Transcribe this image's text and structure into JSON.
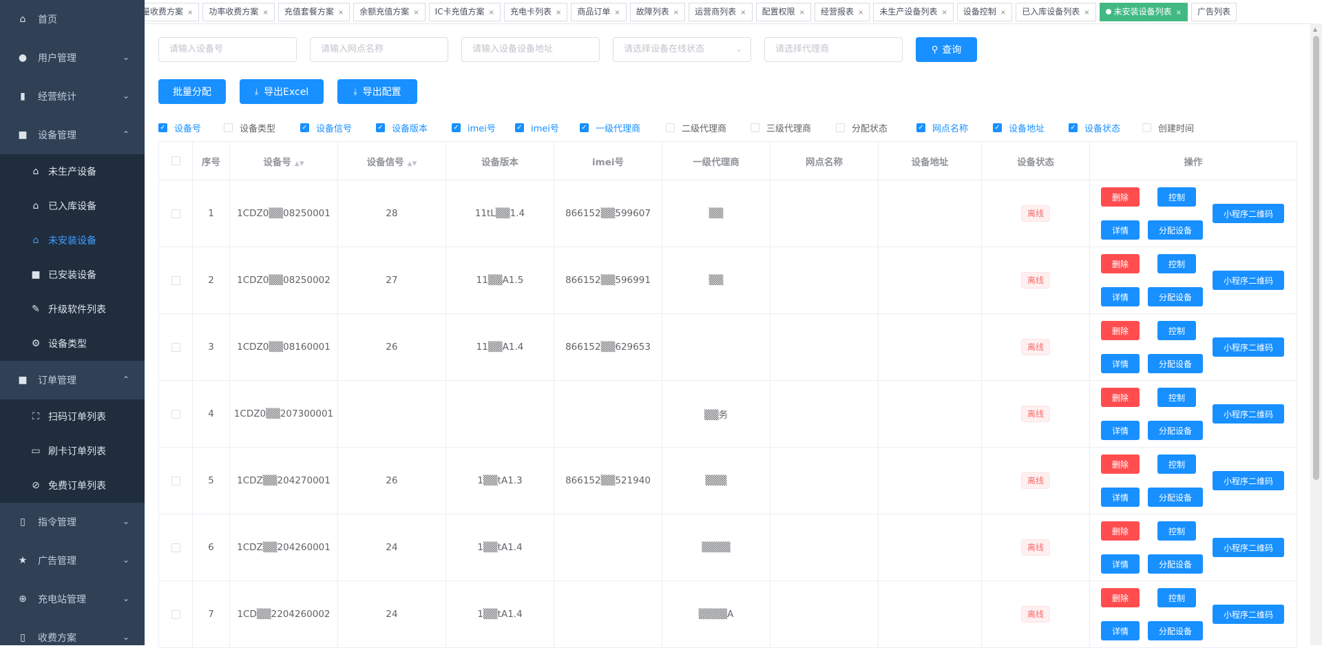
{
  "sidebar": {
    "home": "首页",
    "user_mgmt": "用户管理",
    "biz_stats": "经营统计",
    "device_mgmt": "设备管理",
    "device_items": [
      {
        "label": "未生产设备",
        "icon": "bag-icon"
      },
      {
        "label": "已入库设备",
        "icon": "bag-in-icon"
      },
      {
        "label": "未安装设备",
        "icon": "bag-plus-icon"
      },
      {
        "label": "已安装设备",
        "icon": "bag-check-icon"
      },
      {
        "label": "升级软件列表",
        "icon": "pen-icon"
      },
      {
        "label": "设备类型",
        "icon": "gear-icon"
      }
    ],
    "order_mgmt": "订单管理",
    "order_items": [
      {
        "label": "扫码订单列表",
        "icon": "scan-icon"
      },
      {
        "label": "刷卡订单列表",
        "icon": "card-icon"
      },
      {
        "label": "免费订单列表",
        "icon": "link-icon"
      }
    ],
    "cmd_mgmt": "指令管理",
    "ad_mgmt": "广告管理",
    "station_mgmt": "充电站管理",
    "fee_plan": "收费方案"
  },
  "tags": [
    "量收费方案",
    "功率收费方案",
    "充值套餐方案",
    "余额充值方案",
    "IC卡充值方案",
    "充电卡列表",
    "商品订单",
    "故障列表",
    "运营商列表",
    "配置权限",
    "经营报表",
    "未生产设备列表",
    "设备控制",
    "已入库设备列表",
    "未安装设备列表",
    "广告列表"
  ],
  "active_tag_index": 14,
  "filters": {
    "device_no_placeholder": "请输入设备号",
    "site_name_placeholder": "请输入网点名称",
    "address_placeholder": "请输入设备设备地址",
    "status_placeholder": "请选择设备在线状态",
    "agent_placeholder": "请选择代理商",
    "query_label": "查询"
  },
  "actions": {
    "batch_assign": "批量分配",
    "export_excel": "导出Excel",
    "export_config": "导出配置"
  },
  "column_toggles": [
    {
      "label": "设备号",
      "checked": true
    },
    {
      "label": "设备类型",
      "checked": false
    },
    {
      "label": "设备信号",
      "checked": true
    },
    {
      "label": "设备版本",
      "checked": true
    },
    {
      "label": "imei号",
      "checked": true
    },
    {
      "label": "imei号",
      "checked": true
    },
    {
      "label": "一级代理商",
      "checked": true
    },
    {
      "label": "二级代理商",
      "checked": false
    },
    {
      "label": "三级代理商",
      "checked": false
    },
    {
      "label": "分配状态",
      "checked": false
    },
    {
      "label": "网点名称",
      "checked": true
    },
    {
      "label": "设备地址",
      "checked": true
    },
    {
      "label": "设备状态",
      "checked": true
    },
    {
      "label": "创建时间",
      "checked": false
    }
  ],
  "table": {
    "headers": [
      "序号",
      "设备号",
      "设备信号",
      "设备版本",
      "imei号",
      "一级代理商",
      "网点名称",
      "设备地址",
      "设备状态",
      "操作"
    ],
    "rows": [
      {
        "idx": "1",
        "device_no": "1CDZ0▒▒08250001",
        "signal": "28",
        "version": "11tL▒▒1.4",
        "imei": "866152▒▒599607",
        "agent": "▒▒",
        "status": "离线"
      },
      {
        "idx": "2",
        "device_no": "1CDZ0▒▒08250002",
        "signal": "27",
        "version": "11▒▒A1.5",
        "imei": "866152▒▒596991",
        "agent": "▒▒",
        "status": "离线"
      },
      {
        "idx": "3",
        "device_no": "1CDZ0▒▒08160001",
        "signal": "26",
        "version": "11▒▒A1.4",
        "imei": "866152▒▒629653",
        "agent": "",
        "status": "离线"
      },
      {
        "idx": "4",
        "device_no": "1CDZ0▒▒207300001",
        "signal": "",
        "version": "",
        "imei": "",
        "agent": "▒▒务",
        "status": "离线"
      },
      {
        "idx": "5",
        "device_no": "1CDZ▒▒204270001",
        "signal": "26",
        "version": "1▒▒tA1.3",
        "imei": "866152▒▒521940",
        "agent": "▒▒▒",
        "status": "离线"
      },
      {
        "idx": "6",
        "device_no": "1CDZ▒▒204260001",
        "signal": "24",
        "version": "1▒▒tA1.4",
        "imei": "",
        "agent": "▒▒▒▒",
        "status": "离线"
      },
      {
        "idx": "7",
        "device_no": "1CD▒▒2204260002",
        "signal": "24",
        "version": "1▒▒tA1.4",
        "imei": "",
        "agent": "▒▒▒▒A",
        "status": "离线"
      }
    ],
    "ops": {
      "delete": "删除",
      "control": "控制",
      "detail": "详情",
      "assign": "分配设备",
      "qrcode": "小程序二维码"
    }
  }
}
